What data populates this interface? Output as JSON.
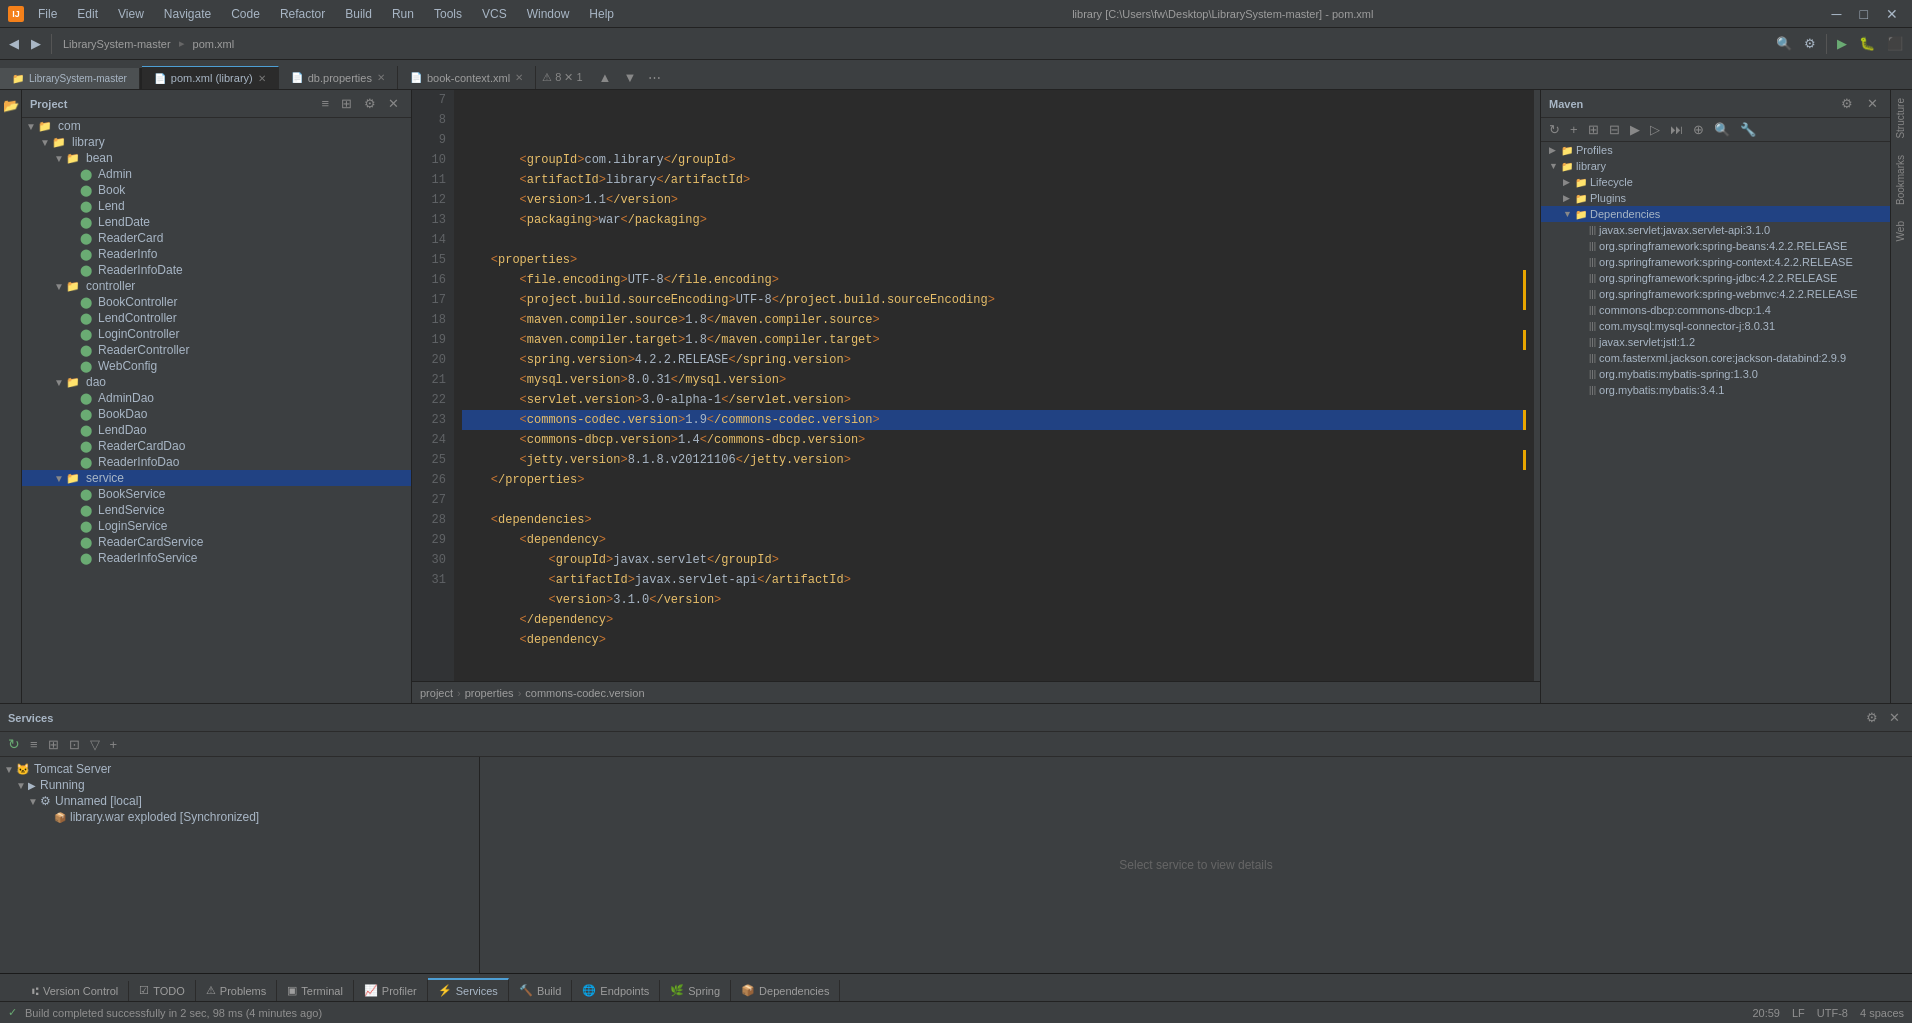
{
  "titlebar": {
    "app_icon": "IJ",
    "title": "library [C:\\Users\\fw\\Desktop\\LibrarySystem-master] - pom.xml",
    "menus": [
      "File",
      "Edit",
      "View",
      "Navigate",
      "Code",
      "Refactor",
      "Build",
      "Run",
      "Tools",
      "VCS",
      "Window",
      "Help"
    ],
    "btn_minimize": "─",
    "btn_maximize": "□",
    "btn_close": "✕"
  },
  "project_tabs": [
    "LibrarySystem-master",
    "pom.xml"
  ],
  "editor_tabs": [
    {
      "label": "pom.xml (library)",
      "active": true
    },
    {
      "label": "db.properties",
      "active": false
    },
    {
      "label": "book-context.xml",
      "active": false
    }
  ],
  "breadcrumb": [
    "project",
    "properties",
    "commons-codec.version"
  ],
  "project_header": "Project",
  "project_tree": [
    {
      "indent": 0,
      "type": "folder",
      "label": "com",
      "expanded": true
    },
    {
      "indent": 1,
      "type": "folder",
      "label": "library",
      "expanded": true
    },
    {
      "indent": 2,
      "type": "folder",
      "label": "bean",
      "expanded": true
    },
    {
      "indent": 3,
      "type": "java",
      "label": "Admin"
    },
    {
      "indent": 3,
      "type": "java",
      "label": "Book"
    },
    {
      "indent": 3,
      "type": "java",
      "label": "Lend"
    },
    {
      "indent": 3,
      "type": "java",
      "label": "LendDate"
    },
    {
      "indent": 3,
      "type": "java",
      "label": "ReaderCard"
    },
    {
      "indent": 3,
      "type": "java",
      "label": "ReaderInfo"
    },
    {
      "indent": 3,
      "type": "java",
      "label": "ReaderInfoDate"
    },
    {
      "indent": 2,
      "type": "folder",
      "label": "controller",
      "expanded": true
    },
    {
      "indent": 3,
      "type": "java",
      "label": "BookController"
    },
    {
      "indent": 3,
      "type": "java",
      "label": "LendController"
    },
    {
      "indent": 3,
      "type": "java",
      "label": "LoginController"
    },
    {
      "indent": 3,
      "type": "java",
      "label": "ReaderController"
    },
    {
      "indent": 3,
      "type": "java",
      "label": "WebConfig"
    },
    {
      "indent": 2,
      "type": "folder",
      "label": "dao",
      "expanded": true
    },
    {
      "indent": 3,
      "type": "java",
      "label": "AdminDao"
    },
    {
      "indent": 3,
      "type": "java",
      "label": "BookDao"
    },
    {
      "indent": 3,
      "type": "java",
      "label": "LendDao"
    },
    {
      "indent": 3,
      "type": "java",
      "label": "ReaderCardDao"
    },
    {
      "indent": 3,
      "type": "java",
      "label": "ReaderInfoDao"
    },
    {
      "indent": 2,
      "type": "folder",
      "label": "service",
      "expanded": true
    },
    {
      "indent": 3,
      "type": "java",
      "label": "BookService"
    },
    {
      "indent": 3,
      "type": "java",
      "label": "LendService"
    },
    {
      "indent": 3,
      "type": "java",
      "label": "LoginService"
    },
    {
      "indent": 3,
      "type": "java",
      "label": "ReaderCardService"
    },
    {
      "indent": 3,
      "type": "java",
      "label": "ReaderInfoService"
    }
  ],
  "code_lines": [
    {
      "num": 7,
      "content": "        <groupId>com.library</groupId>",
      "tags": [
        "groupId"
      ]
    },
    {
      "num": 8,
      "content": "        <artifactId>library</artifactId>",
      "tags": [
        "artifactId"
      ]
    },
    {
      "num": 9,
      "content": "        <version>1.1</version>",
      "tags": [
        "version"
      ]
    },
    {
      "num": 10,
      "content": "        <packaging>war</packaging>",
      "tags": [
        "packaging"
      ]
    },
    {
      "num": 11,
      "content": ""
    },
    {
      "num": 12,
      "content": "    <properties>",
      "tags": [
        "properties"
      ]
    },
    {
      "num": 13,
      "content": "        <file.encoding>UTF-8</file.encoding>",
      "tags": [
        "file.encoding"
      ]
    },
    {
      "num": 14,
      "content": "        <project.build.sourceEncoding>UTF-8</project.build.sourceEncoding>",
      "tags": [
        "project.build.sourceEncoding"
      ]
    },
    {
      "num": 15,
      "content": "        <maven.compiler.source>1.8</maven.compiler.source>",
      "tags": [
        "maven.compiler.source"
      ]
    },
    {
      "num": 16,
      "content": "        <maven.compiler.target>1.8</maven.compiler.target>",
      "tags": [
        "maven.compiler.target"
      ]
    },
    {
      "num": 17,
      "content": "        <spring.version>4.2.2.RELEASE</spring.version>",
      "tags": [
        "spring.version"
      ]
    },
    {
      "num": 18,
      "content": "        <mysql.version>8.0.31</mysql.version>",
      "tags": [
        "mysql.version"
      ]
    },
    {
      "num": 19,
      "content": "        <servlet.version>3.0-alpha-1</servlet.version>",
      "tags": [
        "servlet.version"
      ]
    },
    {
      "num": 20,
      "content": "        <commons-codec.version>1.9</commons-codec.version>",
      "tags": [
        "commons-codec.version"
      ],
      "highlight": true,
      "yellow_mark": true
    },
    {
      "num": 21,
      "content": "        <commons-dbcp.version>1.4</commons-dbcp.version>",
      "tags": [
        "commons-dbcp.version"
      ]
    },
    {
      "num": 22,
      "content": "        <jetty.version>8.1.8.v20121106</jetty.version>",
      "tags": [
        "jetty.version"
      ]
    },
    {
      "num": 23,
      "content": "    </properties>",
      "tags": [
        "properties"
      ]
    },
    {
      "num": 24,
      "content": ""
    },
    {
      "num": 25,
      "content": "    <dependencies>",
      "tags": [
        "dependencies"
      ]
    },
    {
      "num": 26,
      "content": "        <dependency>",
      "tags": [
        "dependency"
      ]
    },
    {
      "num": 27,
      "content": "            <groupId>javax.servlet</groupId>",
      "tags": [
        "groupId"
      ]
    },
    {
      "num": 28,
      "content": "            <artifactId>javax.servlet-api</artifactId>",
      "tags": [
        "artifactId"
      ]
    },
    {
      "num": 29,
      "content": "            <version>3.1.0</version>",
      "tags": [
        "version"
      ]
    },
    {
      "num": 30,
      "content": "        </dependency>",
      "tags": [
        "dependency"
      ]
    },
    {
      "num": 31,
      "content": "        <dependency>",
      "tags": [
        "dependency"
      ]
    }
  ],
  "maven_panel": {
    "title": "Maven",
    "tree": [
      {
        "indent": 0,
        "type": "folder",
        "label": "Profiles",
        "expanded": false
      },
      {
        "indent": 0,
        "type": "folder",
        "label": "library",
        "expanded": true
      },
      {
        "indent": 1,
        "type": "folder",
        "label": "Lifecycle",
        "expanded": false
      },
      {
        "indent": 1,
        "type": "folder",
        "label": "Plugins",
        "expanded": false
      },
      {
        "indent": 1,
        "type": "folder",
        "label": "Dependencies",
        "expanded": true,
        "selected": true
      },
      {
        "indent": 2,
        "type": "dep",
        "label": "javax.servlet:javax.servlet-api:3.1.0"
      },
      {
        "indent": 2,
        "type": "dep",
        "label": "org.springframework:spring-beans:4.2.2.RELEASE"
      },
      {
        "indent": 2,
        "type": "dep",
        "label": "org.springframework:spring-context:4.2.2.RELEASE"
      },
      {
        "indent": 2,
        "type": "dep",
        "label": "org.springframework:spring-jdbc:4.2.2.RELEASE"
      },
      {
        "indent": 2,
        "type": "dep",
        "label": "org.springframework:spring-webmvc:4.2.2.RELEASE"
      },
      {
        "indent": 2,
        "type": "dep",
        "label": "commons-dbcp:commons-dbcp:1.4"
      },
      {
        "indent": 2,
        "type": "dep",
        "label": "com.mysql:mysql-connector-j:8.0.31"
      },
      {
        "indent": 2,
        "type": "dep",
        "label": "javax.servlet:jstl:1.2"
      },
      {
        "indent": 2,
        "type": "dep",
        "label": "com.fasterxml.jackson.core:jackson-databind:2.9.9"
      },
      {
        "indent": 2,
        "type": "dep",
        "label": "org.mybatis:mybatis-spring:1.3.0"
      },
      {
        "indent": 2,
        "type": "dep",
        "label": "org.mybatis:mybatis:3.4.1"
      }
    ]
  },
  "services_panel": {
    "title": "Services",
    "tree": [
      {
        "indent": 0,
        "type": "server",
        "label": "Tomcat Server",
        "expanded": true
      },
      {
        "indent": 1,
        "type": "running",
        "label": "Running",
        "expanded": true
      },
      {
        "indent": 2,
        "type": "unnamed",
        "label": "Unnamed [local]",
        "expanded": true
      },
      {
        "indent": 3,
        "type": "deploy",
        "label": "library.war exploded [Synchronized]"
      }
    ],
    "detail_placeholder": "Select service to view details"
  },
  "bottom_tabs": [
    {
      "label": "Version Control"
    },
    {
      "label": "TODO"
    },
    {
      "label": "Problems"
    },
    {
      "label": "Terminal"
    },
    {
      "label": "Profiler"
    },
    {
      "label": "Services",
      "active": true
    },
    {
      "label": "Build"
    },
    {
      "label": "Endpoints"
    },
    {
      "label": "Spring"
    },
    {
      "label": "Dependencies"
    }
  ],
  "statusbar": {
    "message": "Build completed successfully in 2 sec, 98 ms (4 minutes ago)",
    "right": [
      "20:59",
      "LF",
      "UTF-8",
      "4 spaces"
    ]
  },
  "gutter_marks": {
    "line13": "#e8a500",
    "line14": "#e8a500",
    "line16": "#e8a500",
    "line20": "#e8a500",
    "line22": "#e8a500"
  },
  "error_badge": "⚠ 8  ✕ 1",
  "right_sidebar_tabs": [
    "Structure",
    "Bookmarks",
    "Web"
  ],
  "left_sidebar_icons": [
    "▶",
    "📁"
  ]
}
